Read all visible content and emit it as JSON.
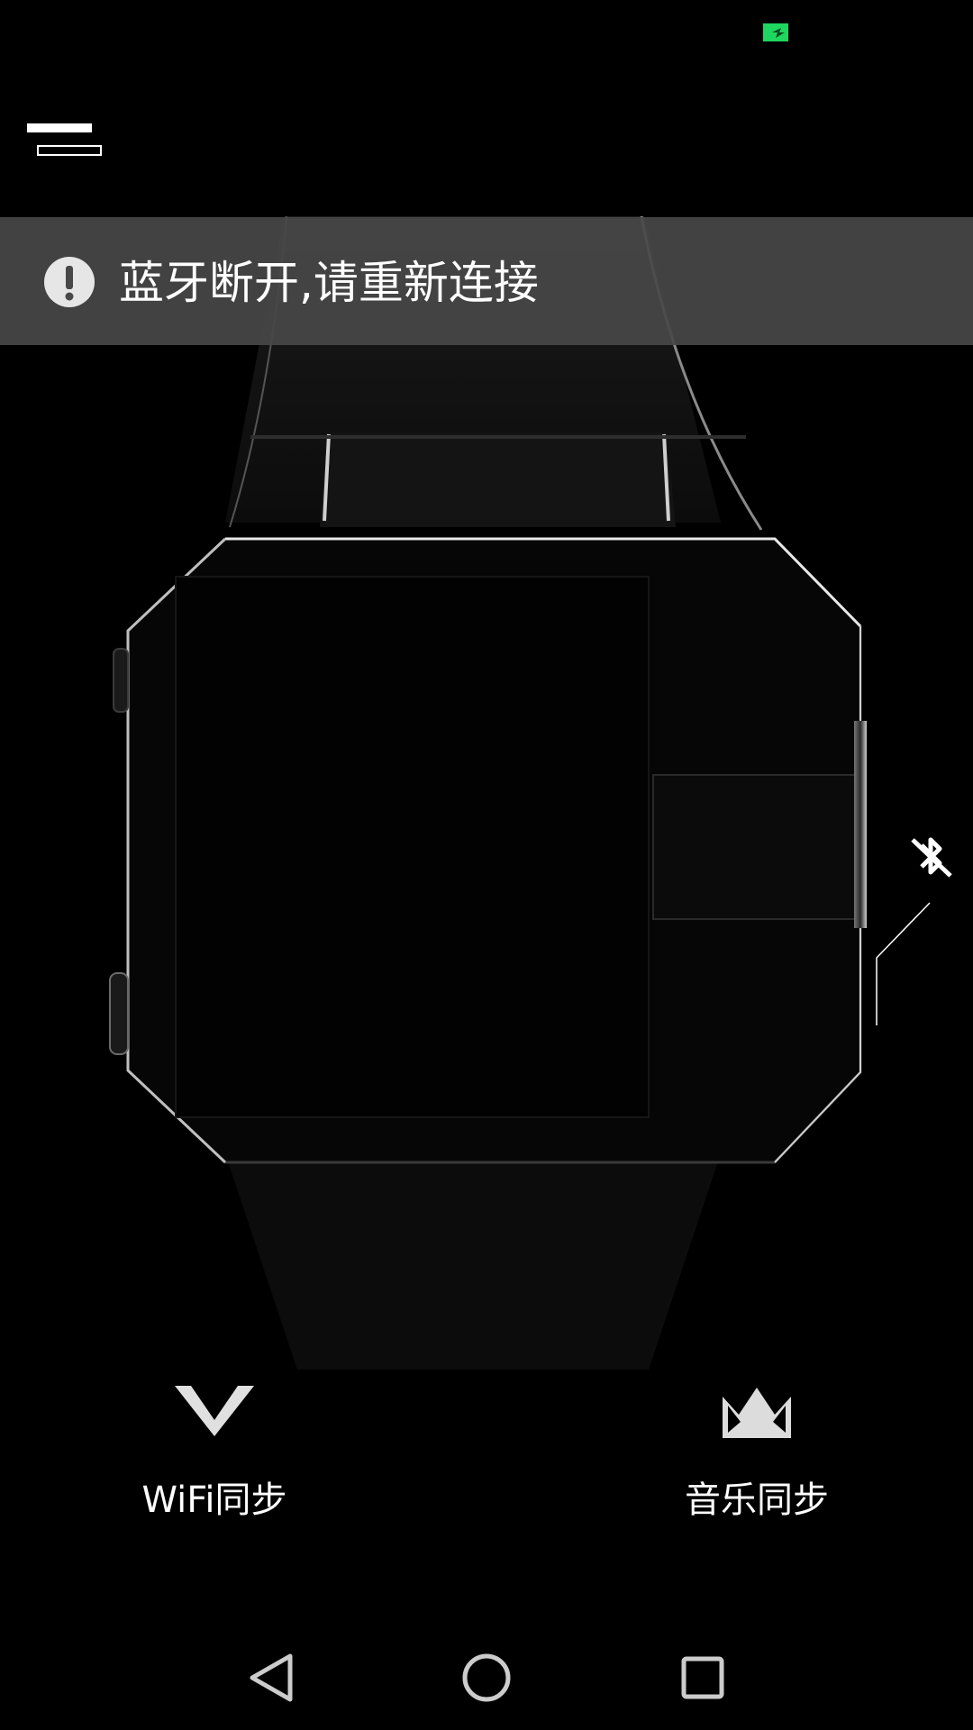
{
  "status_bar": {
    "battery_icon": "battery-charging-icon",
    "battery_color": "#1ed760"
  },
  "header": {
    "menu_icon": "menu-icon"
  },
  "alert": {
    "icon": "exclamation-icon",
    "text": "蓝牙断开,请重新连接",
    "background": "#484848"
  },
  "watch": {
    "icon": "smartwatch-image",
    "bluetooth_status_icon": "bluetooth-disabled-icon"
  },
  "actions": [
    {
      "label": "WiFi同步",
      "icon": "triangle-down-icon"
    },
    {
      "label": "音乐同步",
      "icon": "crown-icon"
    }
  ],
  "nav_bar": {
    "back_icon": "back-triangle-icon",
    "home_icon": "home-circle-icon",
    "recent_icon": "recent-square-icon"
  }
}
